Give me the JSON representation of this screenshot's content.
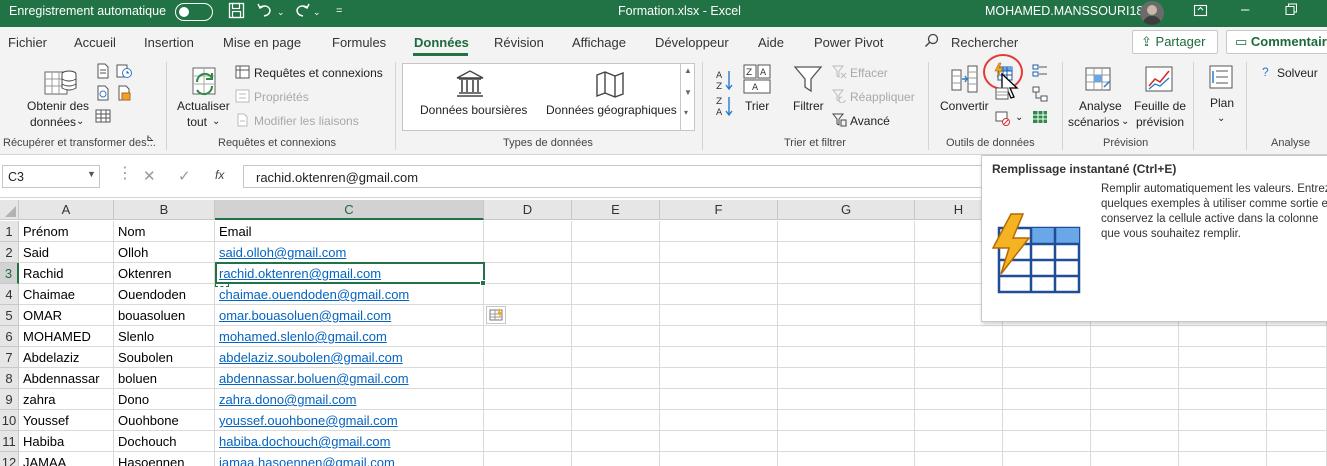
{
  "titlebar": {
    "autosave_label": "Enregistrement automatique",
    "file_title": "Formation.xlsx  -  Excel",
    "user_name": "MOHAMED.MANSSOURI18",
    "accent": "#217346"
  },
  "tabs": [
    "Fichier",
    "Accueil",
    "Insertion",
    "Mise en page",
    "Formules",
    "Données",
    "Révision",
    "Affichage",
    "Développeur",
    "Aide",
    "Power Pivot"
  ],
  "active_tab": "Données",
  "search_label": "Rechercher",
  "share_label": "Partager",
  "comments_label": "Commentaires",
  "ribbon": {
    "get": {
      "obtain_line1": "Obtenir des",
      "obtain_line2": "données",
      "group": "Récupérer et transformer des..."
    },
    "queries": {
      "refresh_line1": "Actualiser",
      "refresh_line2": "tout",
      "queries_conn": "Requêtes et connexions",
      "properties": "Propriétés",
      "edit_links": "Modifier les liaisons",
      "group": "Requêtes et connexions"
    },
    "types": {
      "stocks": "Données boursières",
      "geo": "Données géographiques",
      "group": "Types de données"
    },
    "sort": {
      "sort": "Trier",
      "filter": "Filtrer",
      "clear": "Effacer",
      "reapply": "Réappliquer",
      "advanced": "Avancé",
      "group": "Trier et filtrer"
    },
    "tools": {
      "convert": "Convertir",
      "group": "Outils de données"
    },
    "forecast": {
      "whatif_line1": "Analyse",
      "whatif_line2": "scénarios",
      "sheet_line1": "Feuille de",
      "sheet_line2": "prévision",
      "group": "Prévision"
    },
    "outline": {
      "plan": "Plan"
    },
    "analysis": {
      "solver": "Solveur",
      "group": "Analyse"
    }
  },
  "formula_bar": {
    "name_box": "C3",
    "fx": "fx",
    "content": "rachid.oktenren@gmail.com"
  },
  "columns": [
    "A",
    "B",
    "C",
    "D",
    "E",
    "F",
    "G",
    "H"
  ],
  "rows": [
    {
      "n": "1",
      "a": "Prénom",
      "b": "Nom",
      "c": "Email"
    },
    {
      "n": "2",
      "a": "Said",
      "b": "Olloh",
      "c": "said.olloh@gmail.com"
    },
    {
      "n": "3",
      "a": "Rachid",
      "b": "Oktenren",
      "c": "rachid.oktenren@gmail.com"
    },
    {
      "n": "4",
      "a": "Chaimae",
      "b": "Ouendoden",
      "c": "chaimae.ouendoden@gmail.com"
    },
    {
      "n": "5",
      "a": "OMAR",
      "b": "bouasoluen",
      "c": "omar.bouasoluen@gmail.com"
    },
    {
      "n": "6",
      "a": "MOHAMED",
      "b": "Slenlo",
      "c": "mohamed.slenlo@gmail.com"
    },
    {
      "n": "7",
      "a": "Abdelaziz",
      "b": "Soubolen",
      "c": "abdelaziz.soubolen@gmail.com"
    },
    {
      "n": "8",
      "a": "Abdennassar",
      "b": "boluen",
      "c": "abdennassar.boluen@gmail.com"
    },
    {
      "n": "9",
      "a": "zahra",
      "b": "Dono",
      "c": "zahra.dono@gmail.com"
    },
    {
      "n": "10",
      "a": "Youssef",
      "b": "Ouohbone",
      "c": "youssef.ouohbone@gmail.com"
    },
    {
      "n": "11",
      "a": "Habiba",
      "b": "Dochouch",
      "c": "habiba.dochouch@gmail.com"
    },
    {
      "n": "12",
      "a": "JAMAA",
      "b": "Hasoennen",
      "c": "jamaa.hasoennen@gmail.com"
    }
  ],
  "tooltip": {
    "title": "Remplissage instantané (Ctrl+E)",
    "lines": [
      "Remplir automatiquement les valeurs. Entrez",
      "quelques exemples à utiliser comme sortie et",
      "conservez la cellule active dans la colonne",
      "que vous souhaitez remplir."
    ]
  }
}
